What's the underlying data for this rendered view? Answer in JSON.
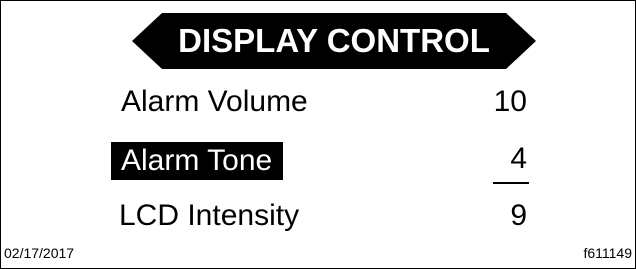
{
  "screen": {
    "title": "DISPLAY CONTROL",
    "settings": [
      {
        "label": "Alarm Volume",
        "value": "10",
        "selected": false
      },
      {
        "label": "Alarm Tone",
        "value": "4",
        "selected": true
      },
      {
        "label": "LCD Intensity",
        "value": "9",
        "selected": false
      }
    ]
  },
  "footer": {
    "date": "02/17/2017",
    "figure_ref": "f611149"
  },
  "colors": {
    "foreground": "#000000",
    "background": "#ffffff",
    "highlight_text": "#ffffff"
  }
}
